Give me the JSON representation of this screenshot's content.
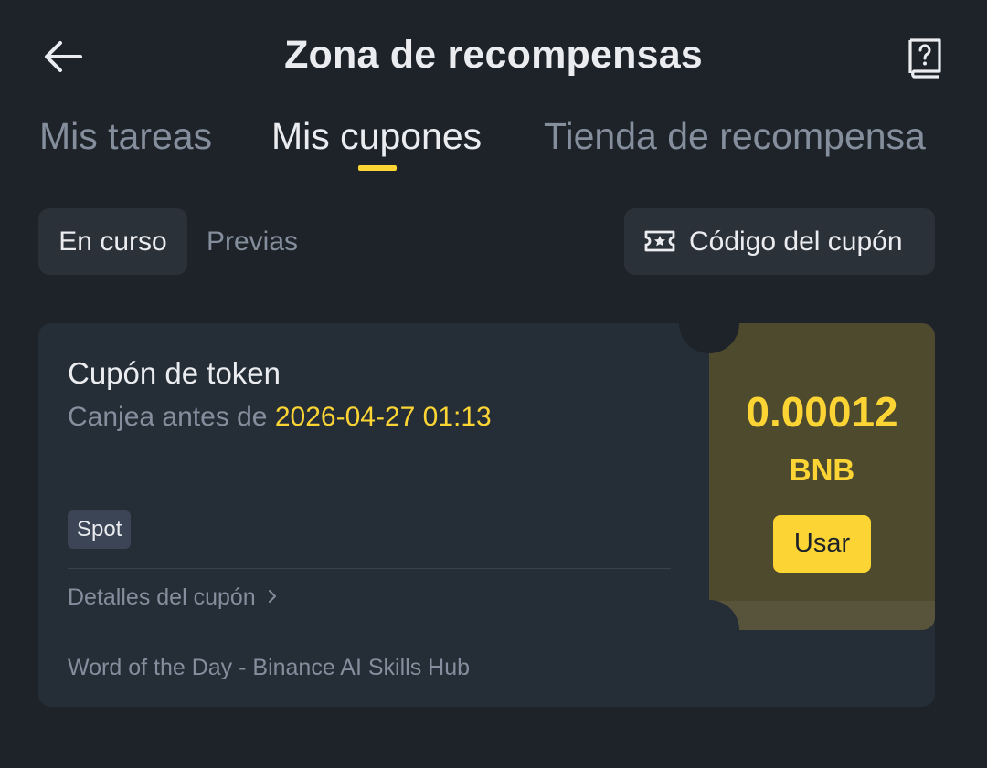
{
  "header": {
    "title": "Zona de recompensas",
    "back_icon": "arrow-left-icon",
    "help_icon": "help-book-icon"
  },
  "tabs": [
    {
      "label": "Mis tareas",
      "active": false
    },
    {
      "label": "Mis cupones",
      "active": true
    },
    {
      "label": "Tienda de recompensa",
      "active": false
    }
  ],
  "filters": {
    "active": "En curso",
    "previous": "Previas",
    "coupon_code": "Código del cupón",
    "coupon_code_icon": "ticket-star-icon"
  },
  "coupon": {
    "title": "Cupón de token",
    "expiry_prefix": "Canjea antes de ",
    "expiry_date": "2026-04-27 01:13",
    "tag": "Spot",
    "details_label": "Detalles del cupón",
    "details_icon": "chevron-right-icon",
    "source": "Word of the Day - Binance AI Skills Hub",
    "amount": "0.00012",
    "token": "BNB",
    "use_label": "Usar"
  },
  "colors": {
    "background": "#1e2329",
    "card": "#252d37",
    "chip": "#2b3139",
    "accent": "#fcd535",
    "text_primary": "#eaecef",
    "text_secondary": "#848e9c",
    "stub": "#4e4a2e"
  }
}
